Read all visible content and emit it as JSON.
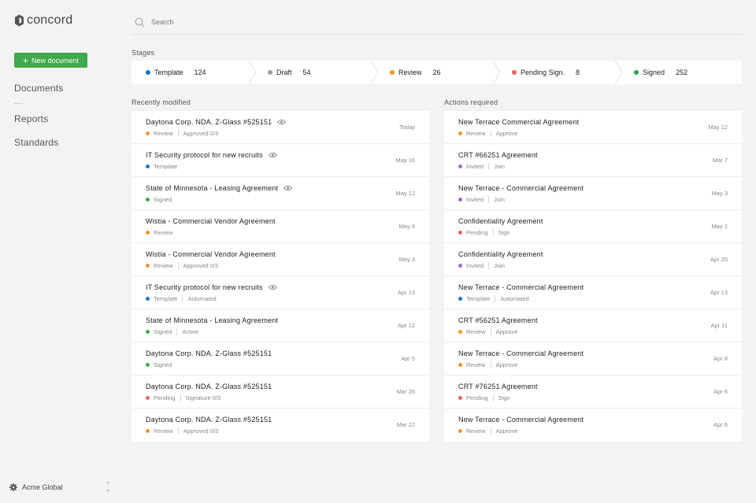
{
  "app": {
    "logo_text": "concord"
  },
  "sidebar": {
    "new_document_label": "New document",
    "nav": [
      "Documents",
      "Reports",
      "Standards"
    ],
    "org_name": "Acme Global"
  },
  "search": {
    "placeholder": "Search"
  },
  "stages": {
    "title": "Stages",
    "items": [
      {
        "label": "Template",
        "count": "124",
        "color": "#1a73b8"
      },
      {
        "label": "Draft",
        "count": "54",
        "color": "#9e9e9e"
      },
      {
        "label": "Review",
        "count": "26",
        "color": "#f0952a"
      },
      {
        "label": "Pending Sign.",
        "count": "8",
        "color": "#e8635a"
      },
      {
        "label": "Signed",
        "count": "252",
        "color": "#2fa34a"
      }
    ]
  },
  "status_colors": {
    "Review": "#f0952a",
    "Template": "#1a73b8",
    "Signed": "#3fa84a",
    "Pending": "#e8635a",
    "Invited": "#9c6ad6"
  },
  "recent": {
    "title": "Recently modified",
    "rows": [
      {
        "title": "Daytona Corp. NDA. Z-Glass #525151",
        "eye": true,
        "status": "Review",
        "extra": "Approved 0/3",
        "date": "Today"
      },
      {
        "title": "IT Security protocol for new recruits",
        "eye": true,
        "status": "Template",
        "extra": "",
        "date": "May 16"
      },
      {
        "title": "State of Minnesota - Leasing Agreement",
        "eye": true,
        "status": "Signed",
        "extra": "",
        "date": "May 12"
      },
      {
        "title": "Wistia - Commercial Vendor Agreement",
        "eye": false,
        "status": "Review",
        "extra": "",
        "date": "May 6"
      },
      {
        "title": "Wistia - Commercial Vendor Agreement",
        "eye": false,
        "status": "Review",
        "extra": "Approved 0/3",
        "date": "May 3"
      },
      {
        "title": "IT Security protocol for new recruits",
        "eye": true,
        "status": "Template",
        "extra": "Automated",
        "date": "Apr 13"
      },
      {
        "title": "State of Minnesota - Leasing Agreement",
        "eye": false,
        "status": "Signed",
        "extra": "Active",
        "date": "Apr 12"
      },
      {
        "title": "Daytona Corp. NDA. Z-Glass #525151",
        "eye": false,
        "status": "Signed",
        "extra": "",
        "date": "Apr 5"
      },
      {
        "title": "Daytona Corp. NDA. Z-Glass #525151",
        "eye": false,
        "status": "Pending",
        "extra": "Signature 0/3",
        "date": "Mar 26"
      },
      {
        "title": "Daytona Corp. NDA. Z-Glass #525151",
        "eye": false,
        "status": "Review",
        "extra": "Approved 0/3",
        "date": "Mar 22"
      }
    ]
  },
  "actions": {
    "title": "Actions required",
    "rows": [
      {
        "title": "New Terrace Commercial Agreement",
        "status": "Review",
        "extra": "Approve",
        "date": "May 12"
      },
      {
        "title": "CRT #66251 Agreement",
        "status": "Invited",
        "extra": "Join",
        "date": "Mar 7"
      },
      {
        "title": "New Terrace - Commercial Agreement",
        "status": "Invited",
        "extra": "Join",
        "date": "May 3"
      },
      {
        "title": "Confidentiality Agreement",
        "status": "Pending",
        "extra": "Sign",
        "date": "May 1"
      },
      {
        "title": "Confidentiality Agreement",
        "status": "Invited",
        "extra": "Join",
        "date": "Apr 25"
      },
      {
        "title": "New Terrace - Commercial Agreement",
        "status": "Template",
        "extra": "Automated",
        "date": "Apr 13"
      },
      {
        "title": "CRT #56251 Agreement",
        "status": "Review",
        "extra": "Approve",
        "date": "Apr 11"
      },
      {
        "title": "New Terrace - Commercial Agreement",
        "status": "Review",
        "extra": "Approve",
        "date": "Apr 8"
      },
      {
        "title": "CRT #76251 Agreement",
        "status": "Pending",
        "extra": "Sign",
        "date": "Apr 6"
      },
      {
        "title": "New Terrace - Commercial Agreement",
        "status": "Review",
        "extra": "Approve",
        "date": "Apr 6"
      }
    ]
  }
}
